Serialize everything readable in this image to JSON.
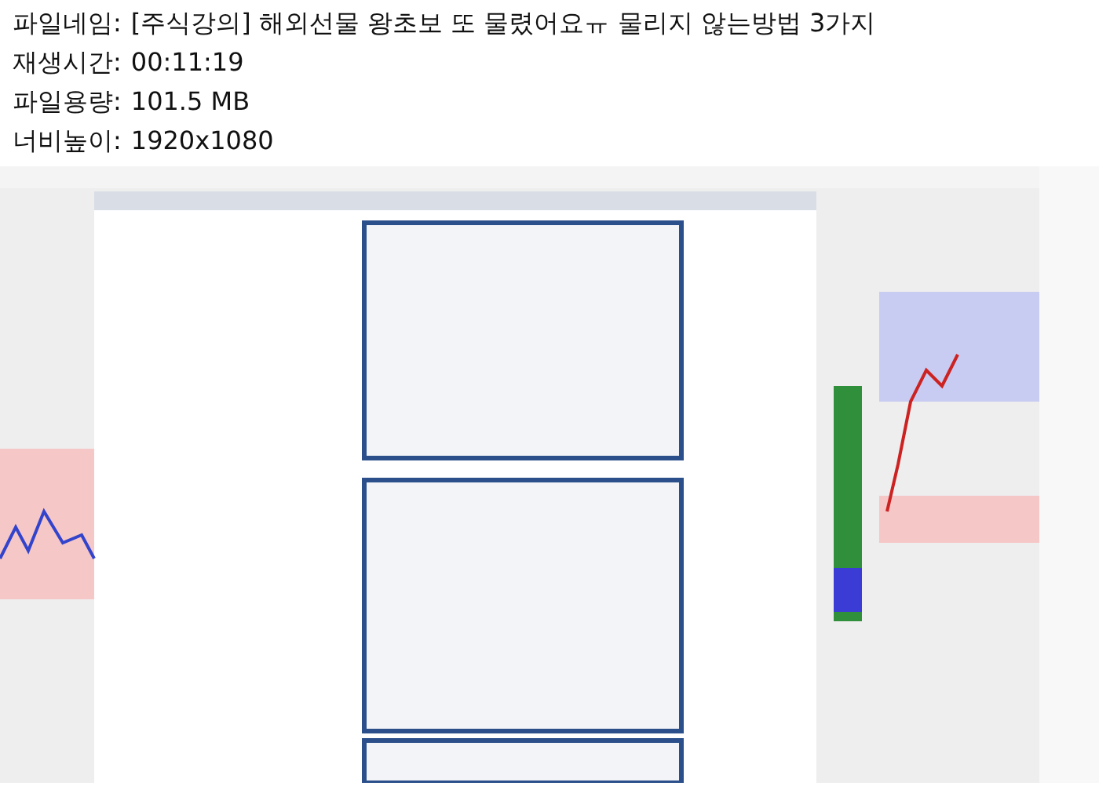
{
  "file_info": [
    {
      "label": "파일네임:",
      "value": "[주식강의] 해외선물 왕초보 또 물렸어요ㅠ 물리지 않는방법 3가지"
    },
    {
      "label": "재생시간:",
      "value": "00:11:19"
    },
    {
      "label": "파일용량:",
      "value": "101.5 MB"
    },
    {
      "label": "너비높이:",
      "value": "1920x1080"
    }
  ]
}
